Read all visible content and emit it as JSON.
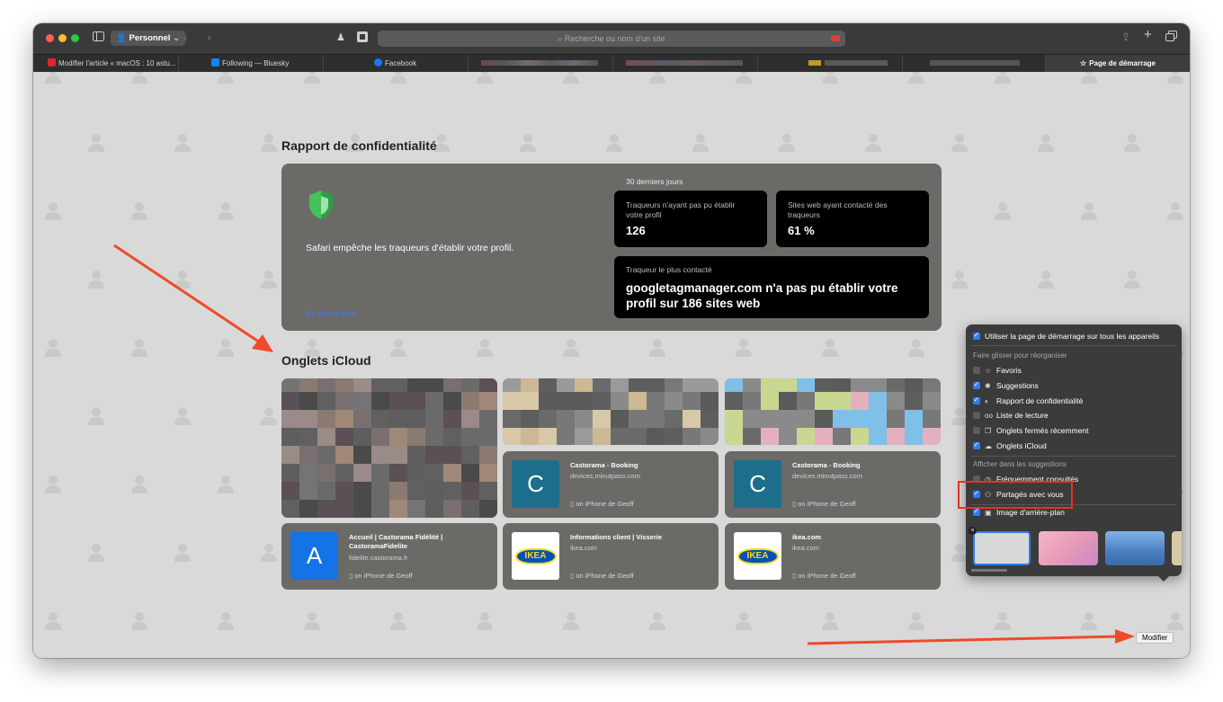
{
  "toolbar": {
    "profile_label": "Personnel",
    "url_placeholder": "Recherche ou nom d'un site"
  },
  "tabs": [
    {
      "label": "Modifier l'article « macOS : 10 astu...",
      "color": "#e0242c"
    },
    {
      "label": "Following — Bluesky",
      "color": "#1185fe"
    },
    {
      "label": "Facebook",
      "color": "#1877f2"
    },
    {
      "label": "",
      "color": "#888888"
    },
    {
      "label": "",
      "color": "#888888"
    },
    {
      "label": "",
      "color": "#888888"
    },
    {
      "label": "",
      "color": "#888888"
    },
    {
      "label": "Page de démarrage",
      "color": "#ffffff"
    }
  ],
  "privacy": {
    "title": "Rapport de confidentialité",
    "description": "Safari empêche les traqueurs d'établir votre profil.",
    "link": "En savoir plus",
    "period": "30 derniers jours",
    "trackers_label": "Traqueurs n'ayant pas pu établir votre profil",
    "trackers_value": "126",
    "sites_label": "Sites web ayant contacté des traqueurs",
    "sites_value": "61 %",
    "top_tracker_label": "Traqueur le plus contacté",
    "top_tracker_value": "googletagmanager.com n'a pas pu établir votre profil sur 186 sites web"
  },
  "icloud": {
    "title": "Onglets iCloud",
    "tiles": [
      {
        "letter": "C",
        "title": "Castorama - Booking",
        "domain": "devices.minutpass.com",
        "device": "on iPhone de Geoff"
      },
      {
        "letter": "C",
        "title": "Castorama - Booking",
        "domain": "devices.minutpass.com",
        "device": "on iPhone de Geoff"
      },
      {
        "letter": "A",
        "title": "Accueil | Castorama Fidélité | CastoramaFidelite",
        "domain": "fidelite.castorama.fr",
        "device": "on iPhone de Geoff"
      },
      {
        "logo": "IKEA",
        "title": "Informations client | Visserie",
        "domain": "ikea.com",
        "device": "on iPhone de Geoff"
      },
      {
        "logo": "IKEA",
        "title": "ikea.com",
        "domain": "ikea.com",
        "device": "on iPhone de Geoff"
      }
    ]
  },
  "panel": {
    "use_everywhere": "Utiliser la page de démarrage sur tous les appareils",
    "reorder_header": "Faire glisser pour réorganiser",
    "items": [
      {
        "label": "Favoris",
        "checked": false,
        "icon": "star-icon"
      },
      {
        "label": "Suggestions",
        "checked": true,
        "icon": "suggestions-icon"
      },
      {
        "label": "Rapport de confidentialité",
        "checked": true,
        "icon": "shield-icon"
      },
      {
        "label": "Liste de lecture",
        "checked": false,
        "icon": "glasses-icon"
      },
      {
        "label": "Onglets fermés récemment",
        "checked": false,
        "icon": "tabs-icon"
      },
      {
        "label": "Onglets iCloud",
        "checked": true,
        "icon": "cloud-icon"
      }
    ],
    "suggestions_header": "Afficher dans les suggestions",
    "suggestion_items": [
      {
        "label": "Fréquemment consultés",
        "checked": false,
        "icon": "clock-icon"
      },
      {
        "label": "Partagés avec vous",
        "checked": true,
        "icon": "people-icon"
      }
    ],
    "background": {
      "label": "Image d'arrière-plan",
      "checked": true
    }
  },
  "modifier_button": "Modifier"
}
